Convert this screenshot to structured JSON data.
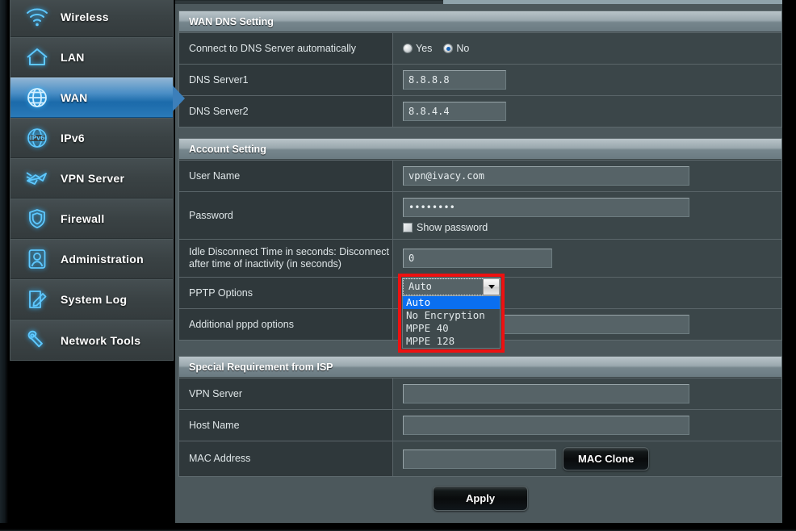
{
  "sidebar": {
    "items": [
      {
        "label": "Wireless",
        "icon": "wifi-icon",
        "active": false
      },
      {
        "label": "LAN",
        "icon": "home-icon",
        "active": false
      },
      {
        "label": "WAN",
        "icon": "globe-icon",
        "active": true
      },
      {
        "label": "IPv6",
        "icon": "ipv6-icon",
        "active": false
      },
      {
        "label": "VPN Server",
        "icon": "vpn-icon",
        "active": false
      },
      {
        "label": "Firewall",
        "icon": "shield-icon",
        "active": false
      },
      {
        "label": "Administration",
        "icon": "user-icon",
        "active": false
      },
      {
        "label": "System Log",
        "icon": "log-edit-icon",
        "active": false
      },
      {
        "label": "Network Tools",
        "icon": "wrench-icon",
        "active": false
      }
    ]
  },
  "panels": {
    "dns": {
      "title": "WAN DNS Setting",
      "auto_dns_label": "Connect to DNS Server automatically",
      "radio_yes": "Yes",
      "radio_no": "No",
      "selected": "No",
      "server1_label": "DNS Server1",
      "server1_value": "8.8.8.8",
      "server2_label": "DNS Server2",
      "server2_value": "8.8.4.4"
    },
    "account": {
      "title": "Account Setting",
      "username_label": "User Name",
      "username_value": "vpn@ivacy.com",
      "password_label": "Password",
      "password_value": "••••••••",
      "show_password_label": "Show password",
      "show_password_checked": false,
      "idle_label": "Idle Disconnect Time in seconds: Disconnect after time of inactivity (in seconds)",
      "idle_value": "0",
      "pptp_label": "PPTP Options",
      "pptp_selected": "Auto",
      "pptp_options": [
        "Auto",
        "No Encryption",
        "MPPE 40",
        "MPPE 128"
      ],
      "pppd_label": "Additional pppd options",
      "pppd_value": ""
    },
    "isp": {
      "title": "Special Requirement from ISP",
      "vpn_server_label": "VPN Server",
      "vpn_server_value": "",
      "host_name_label": "Host Name",
      "host_name_value": "",
      "mac_label": "MAC Address",
      "mac_value": "",
      "mac_clone_button": "MAC Clone"
    }
  },
  "footer": {
    "apply_button": "Apply"
  },
  "colors": {
    "accent_blue": "#1b6aaa",
    "annotation_red": "#ee1111",
    "select_highlight": "#0a6ff0",
    "panel_bg": "#4c585c",
    "row_label_bg": "#2f383b",
    "row_field_bg": "#3b4649"
  }
}
